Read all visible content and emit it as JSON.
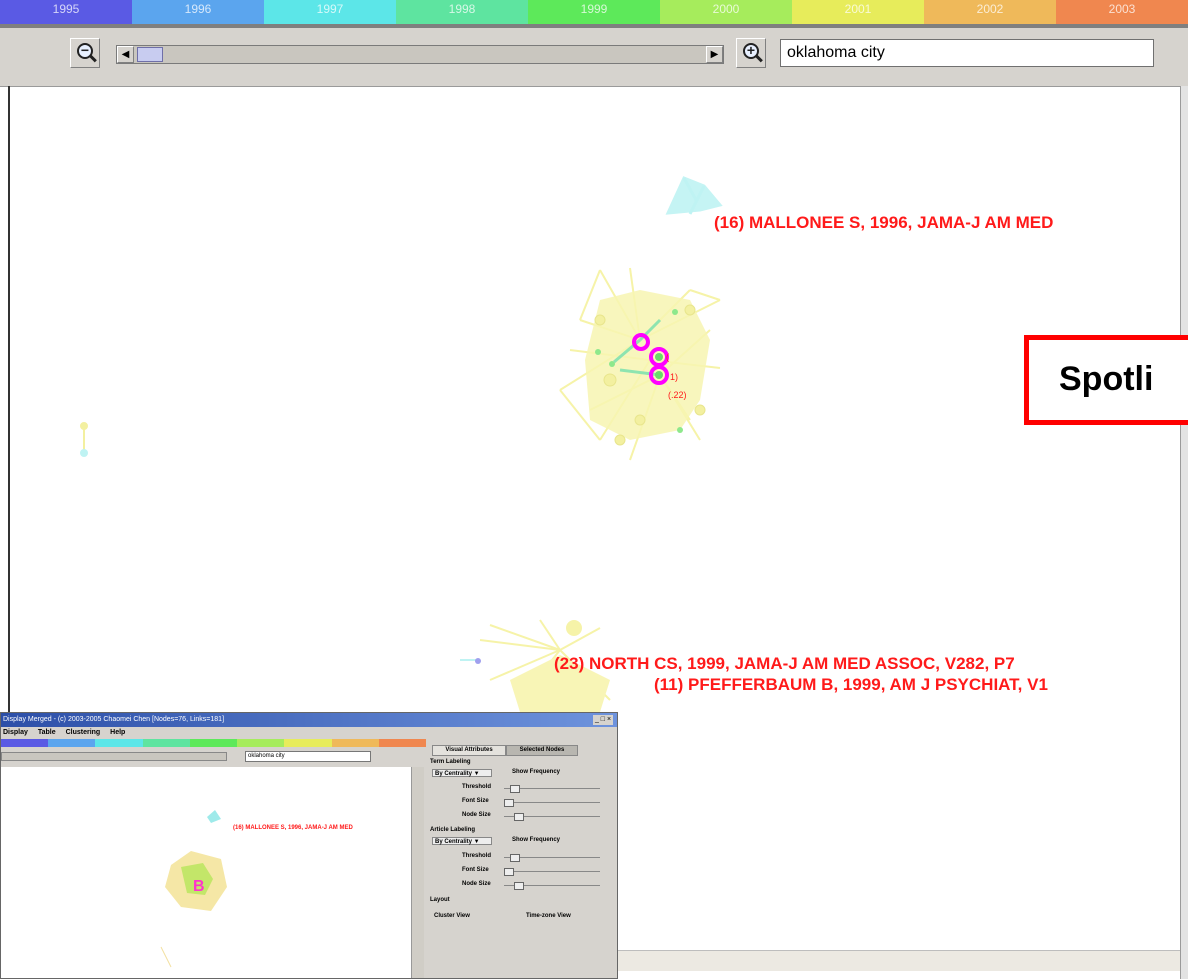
{
  "timeline": {
    "years": [
      {
        "label": "1995",
        "color": "#5a5ae4"
      },
      {
        "label": "1996",
        "color": "#5ba5ee"
      },
      {
        "label": "1997",
        "color": "#5ce6e8"
      },
      {
        "label": "1998",
        "color": "#5ee4a0"
      },
      {
        "label": "1999",
        "color": "#5de95a"
      },
      {
        "label": "2000",
        "color": "#a6ec5c"
      },
      {
        "label": "2001",
        "color": "#e7ec5b"
      },
      {
        "label": "2002",
        "color": "#efb95a"
      },
      {
        "label": "2003",
        "color": "#f0874f"
      }
    ]
  },
  "toolbar": {
    "zoom_out_label": "−",
    "zoom_in_label": "+",
    "scroll_left": "◀",
    "scroll_right": "▶",
    "search_value": "oklahoma city"
  },
  "graph_labels": {
    "mallonee": "(16) MALLONEE S, 1996, JAMA-J AM MED",
    "north": "(23) NORTH CS, 1999, JAMA-J AM MED ASSOC, V282, P7",
    "pfefferbaum": "(11) PFEFFERBAUM B, 1999, AM J PSYCHIAT, V1",
    "small_1": "(",
    "small_2": "1)",
    "small_3": "(.22)"
  },
  "spotlight": {
    "text": "Spotli"
  },
  "inset": {
    "title": "Display Merged - (c) 2003-2005 Chaomei Chen [Nodes=76, Links=181]",
    "window_buttons": "_ □ ×",
    "menu": [
      "Display",
      "Table",
      "Clustering",
      "Help"
    ],
    "search_value": "oklahoma city",
    "node_label": "(16) MALLONEE S, 1996, JAMA-J AM MED",
    "panel": {
      "tabs": [
        "Visual Attributes",
        "Selected Nodes"
      ],
      "term_labeling": "Term Labeling",
      "article_labeling": "Article Labeling",
      "by_centrality": "By Centrality ▼",
      "show_frequency": "Show Frequency",
      "threshold": "Threshold",
      "font_size": "Font Size",
      "node_size": "Node Size",
      "layout": "Layout",
      "cluster_view": "Cluster View",
      "timezone_view": "Time-zone View"
    }
  }
}
